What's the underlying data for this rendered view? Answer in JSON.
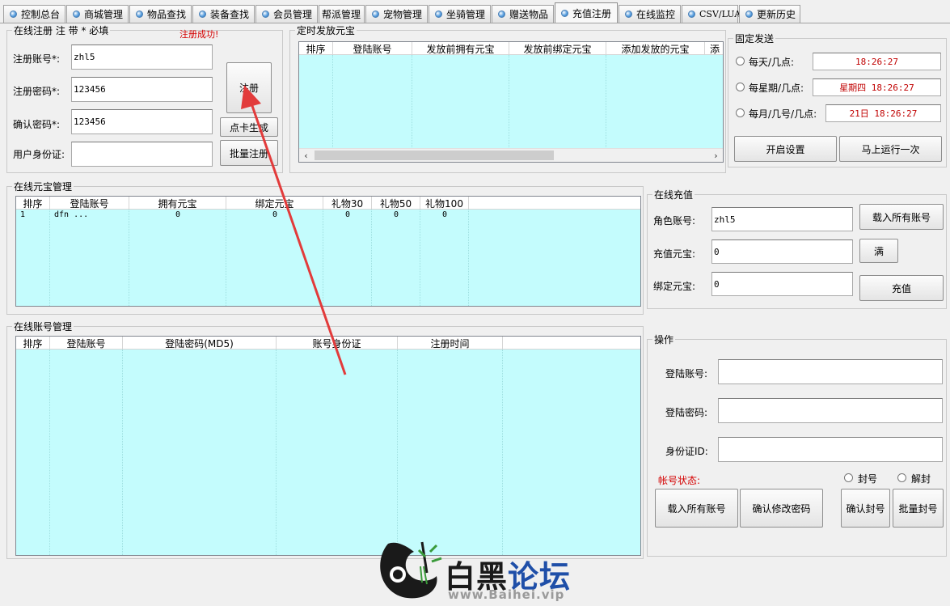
{
  "tabs": [
    {
      "label": "控制总台"
    },
    {
      "label": "商城管理"
    },
    {
      "label": "物品查找"
    },
    {
      "label": "装备查找"
    },
    {
      "label": "会员管理"
    },
    {
      "label": "帮派管理"
    },
    {
      "label": "宠物管理"
    },
    {
      "label": "坐骑管理"
    },
    {
      "label": "赠送物品"
    },
    {
      "label": "充值注册"
    },
    {
      "label": "在线监控"
    },
    {
      "label": "CSV/LUA"
    },
    {
      "label": "更新历史"
    }
  ],
  "register": {
    "legend": "在线注册  注 带 * 必填",
    "success_msg": "注册成功!",
    "account_label": "注册账号*:",
    "account_value": "zhl5",
    "password_label": "注册密码*:",
    "password_value": "123456",
    "confirm_label": "确认密码*:",
    "confirm_value": "123456",
    "idcard_label": "用户身份证:",
    "idcard_value": "",
    "register_btn": "注册",
    "card_btn": "点卡生成",
    "batch_btn": "批量注册"
  },
  "scheduled": {
    "legend": "定时发放元宝",
    "columns": [
      "排序",
      "登陆账号",
      "发放前拥有元宝",
      "发放前绑定元宝",
      "添加发放的元宝",
      "添"
    ]
  },
  "fixed_send": {
    "legend": "固定发送",
    "daily_label": "每天/几点:",
    "daily_value": "18:26:27",
    "weekly_label": "每星期/几点:",
    "weekly_value": "星期四 18:26:27",
    "monthly_label": "每月/几号/几点:",
    "monthly_value": "21日 18:26:27",
    "enable_btn": "开启设置",
    "run_btn": "马上运行一次"
  },
  "yuanbao": {
    "legend": "在线元宝管理",
    "columns": [
      "排序",
      "登陆账号",
      "拥有元宝",
      "绑定元宝",
      "礼物30",
      "礼物50",
      "礼物100"
    ],
    "rows": [
      {
        "no": "1",
        "account": "dfn          ...",
        "own": "0",
        "bound": "0",
        "g30": "0",
        "g50": "0",
        "g100": "0"
      }
    ]
  },
  "recharge": {
    "legend": "在线充值",
    "role_label": "角色账号:",
    "role_value": "zhl5",
    "yb_label": "充值元宝:",
    "yb_value": "0",
    "bound_label": "绑定元宝:",
    "bound_value": "0",
    "load_btn": "载入所有账号",
    "full_btn": "满",
    "recharge_btn": "充值"
  },
  "accounts": {
    "legend": "在线账号管理",
    "columns": [
      "排序",
      "登陆账号",
      "登陆密码(MD5)",
      "账号身份证",
      "注册时间"
    ]
  },
  "ops": {
    "legend": "操作",
    "login_label": "登陆账号:",
    "login_value": "",
    "pwd_label": "登陆密码:",
    "pwd_value": "",
    "id_label": "身份证ID:",
    "id_value": "",
    "status_label": "帐号状态:",
    "ban_label": "封号",
    "unban_label": "解封",
    "load_btn": "载入所有账号",
    "change_pwd_btn": "确认修改密码",
    "confirm_ban_btn": "确认封号",
    "batch_ban_btn": "批量封号"
  },
  "watermark": {
    "title_black": "白黑",
    "title_blue": "论坛",
    "url": "www.Baihei.vip"
  },
  "colors": {
    "listview_bg": "#c4fcfd",
    "success_red": "#d40000",
    "arrow_red": "#e23b3b"
  }
}
